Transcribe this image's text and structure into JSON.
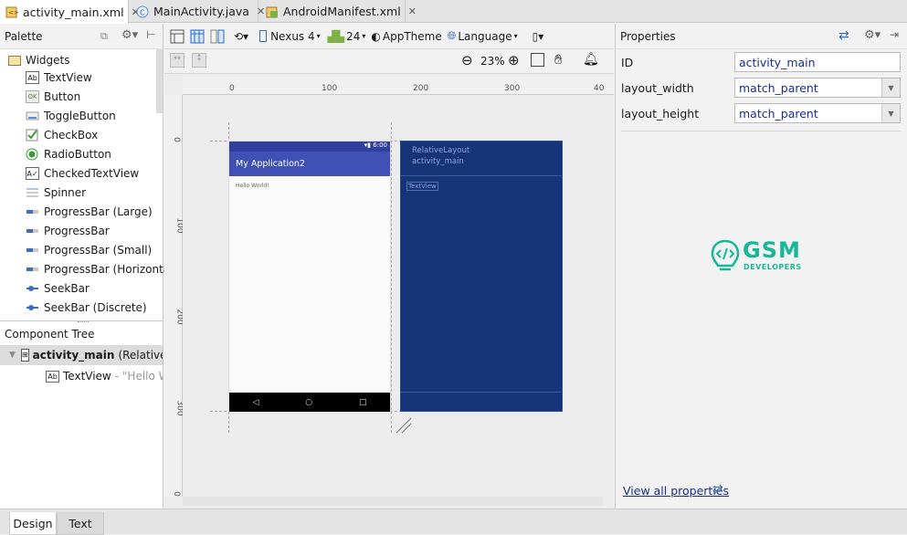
{
  "tabs": [
    {
      "label": "activity_main.xml",
      "icon": "xml-file-icon",
      "active": true
    },
    {
      "label": "MainActivity.java",
      "icon": "java-class-icon",
      "active": false
    },
    {
      "label": "AndroidManifest.xml",
      "icon": "manifest-file-icon",
      "active": false
    }
  ],
  "palette": {
    "title": "Palette",
    "group": "Widgets",
    "items": [
      {
        "label": "TextView",
        "icon": "Ab"
      },
      {
        "label": "Button",
        "icon": "OK"
      },
      {
        "label": "ToggleButton",
        "icon": "toggle"
      },
      {
        "label": "CheckBox",
        "icon": "check"
      },
      {
        "label": "RadioButton",
        "icon": "radio"
      },
      {
        "label": "CheckedTextView",
        "icon": "checked-text"
      },
      {
        "label": "Spinner",
        "icon": "spinner"
      },
      {
        "label": "ProgressBar (Large)",
        "icon": "progress"
      },
      {
        "label": "ProgressBar",
        "icon": "progress"
      },
      {
        "label": "ProgressBar (Small)",
        "icon": "progress"
      },
      {
        "label": "ProgressBar (Horizontal)",
        "icon": "progress"
      },
      {
        "label": "SeekBar",
        "icon": "seekbar"
      },
      {
        "label": "SeekBar (Discrete)",
        "icon": "seekbar"
      }
    ]
  },
  "component_tree": {
    "title": "Component Tree",
    "root_name": "activity_main",
    "root_type": "(RelativeLa",
    "child_name": "TextView",
    "child_value": "- \"Hello Wo"
  },
  "editor_toolbar": {
    "device": "Nexus 4",
    "api": "24",
    "theme": "AppTheme",
    "language": "Language",
    "zoom": "23%"
  },
  "rulers": {
    "top": [
      "0",
      "100",
      "200",
      "300",
      "40"
    ],
    "left": [
      "0",
      "100",
      "200",
      "300",
      "0"
    ]
  },
  "design": {
    "status_time": "6:00",
    "app_title": "My Application2",
    "hello_text": "Hello World!",
    "blueprint_layout": "RelativeLayout",
    "blueprint_id": "activity_main",
    "blueprint_textview": "TextView"
  },
  "properties": {
    "title": "Properties",
    "rows": [
      {
        "label": "ID",
        "value": "activity_main",
        "dropdown": false
      },
      {
        "label": "layout_width",
        "value": "match_parent",
        "dropdown": true
      },
      {
        "label": "layout_height",
        "value": "match_parent",
        "dropdown": true
      }
    ],
    "view_all": "View all properties",
    "watermark_main": "GSM",
    "watermark_sub": "DEVELOPERS"
  },
  "bottom_tabs": [
    {
      "label": "Design",
      "active": true
    },
    {
      "label": "Text",
      "active": false
    }
  ],
  "colors": {
    "accent_blue": "#3f51b5",
    "blueprint": "#173478",
    "watermark": "#17b897",
    "link": "#1b2c8f"
  }
}
